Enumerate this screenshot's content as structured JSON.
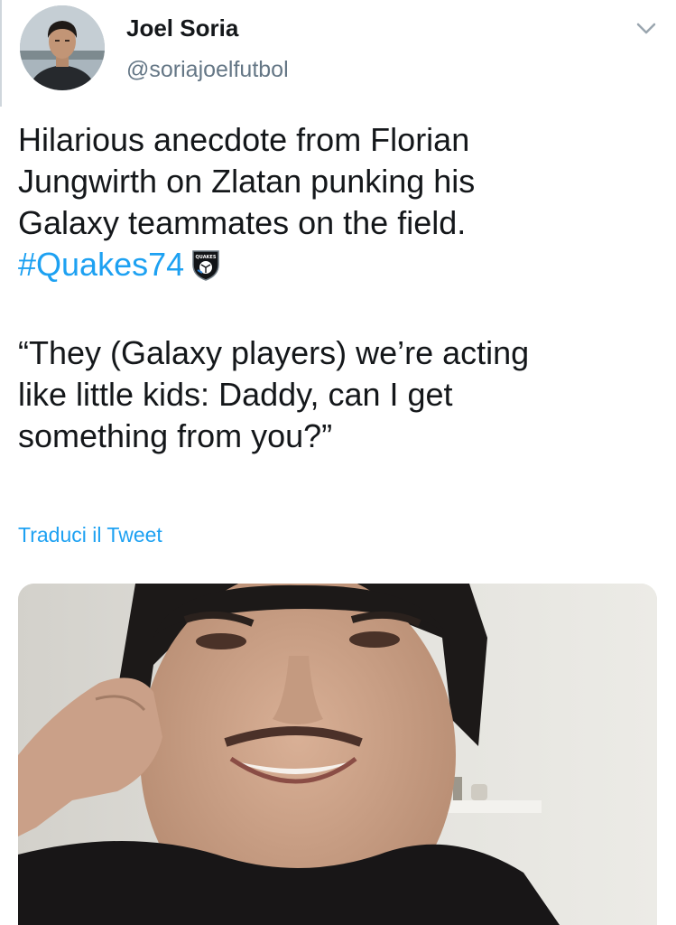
{
  "author": {
    "name": "Joel Soria",
    "handle": "@soriajoelfutbol",
    "avatar_icon": "profile-photo"
  },
  "tweet": {
    "lines": [
      "Hilarious anecdote from Florian",
      "Jungwirth on Zlatan punking his",
      "Galaxy teammates on the field."
    ],
    "hashtag": "#Quakes74",
    "hashtag_badge_icon": "quakes-shield-icon",
    "badge_text": "QUAKES",
    "quote_lines": [
      "“They (Galaxy players) we’re acting",
      "like little kids: Daddy, can I get",
      "something from you?”"
    ]
  },
  "translate_label": "Traduci il Tweet",
  "menu_icon": "chevron-down-icon",
  "colors": {
    "link": "#1da1f2",
    "text": "#14171a",
    "secondary": "#657786"
  }
}
